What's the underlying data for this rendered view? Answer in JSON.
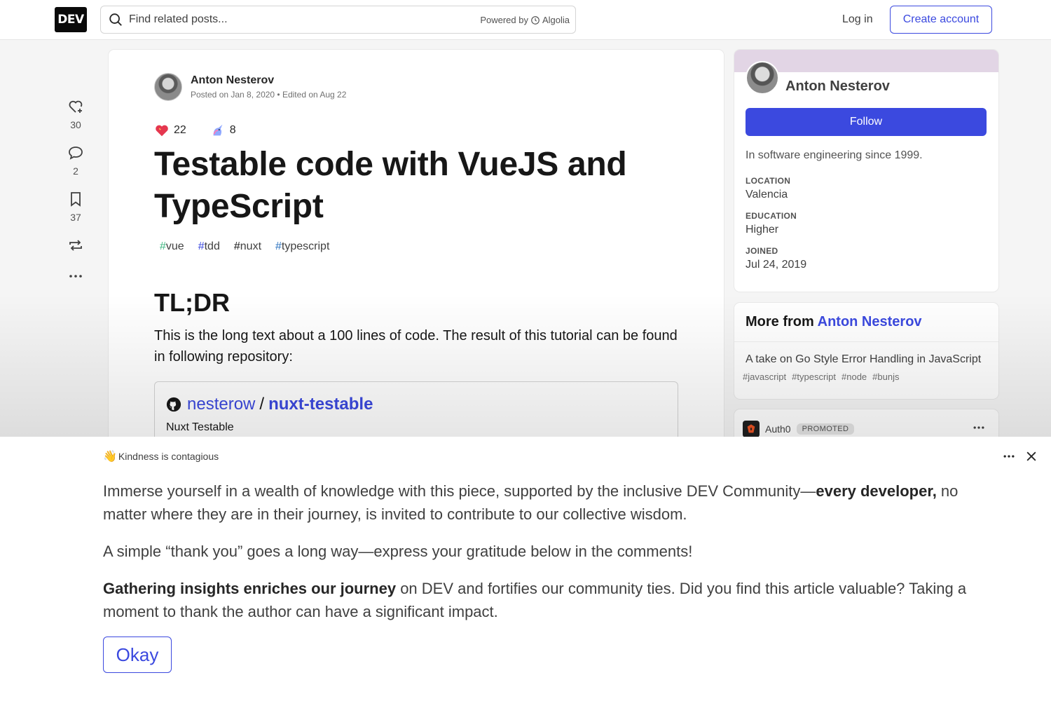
{
  "header": {
    "logo": "DEV",
    "search_placeholder": "Find related posts...",
    "powered_by": "Powered by",
    "powered_brand": "Algolia",
    "login": "Log in",
    "create_account": "Create account"
  },
  "rail": {
    "likes": "30",
    "comments": "2",
    "bookmarks": "37"
  },
  "article": {
    "author": "Anton Nesterov",
    "posted": "Posted on Jan 8, 2020 • Edited on Aug 22",
    "reactions": [
      {
        "icon": "heart-emoji",
        "count": "22"
      },
      {
        "icon": "unicorn-emoji",
        "count": "8"
      }
    ],
    "title": "Testable code with VueJS and TypeScript",
    "tags": [
      {
        "name": "vue",
        "color": "#41b883"
      },
      {
        "name": "tdd",
        "color": "#3b49df"
      },
      {
        "name": "nuxt",
        "color": "#171717"
      },
      {
        "name": "typescript",
        "color": "#2f74c0"
      }
    ],
    "heading": "TL;DR",
    "paragraph": "This is the long text about a 100 lines of code. The result of this tutorial can be found in following repository:",
    "repo": {
      "owner": "nesterow",
      "slash": "/",
      "name": "nuxt-testable",
      "description": "Nuxt Testable"
    }
  },
  "profile": {
    "name": "Anton Nesterov",
    "follow": "Follow",
    "bio": "In software engineering since 1999.",
    "facts": [
      {
        "key": "LOCATION",
        "value": "Valencia"
      },
      {
        "key": "EDUCATION",
        "value": "Higher"
      },
      {
        "key": "JOINED",
        "value": "Jul 24, 2019"
      }
    ]
  },
  "more_from": {
    "label": "More from",
    "author": "Anton Nesterov",
    "post_title": "A take on Go Style Error Handling in JavaScript",
    "post_tags": [
      "#javascript",
      "#typescript",
      "#node",
      "#bunjs"
    ]
  },
  "promo": {
    "name": "Auth0",
    "badge": "PROMOTED"
  },
  "banner": {
    "heading_emoji": "👋",
    "heading": "Kindness is contagious",
    "p1_a": "Immerse yourself in a wealth of knowledge with this piece, supported by the inclusive DEV Community—",
    "p1_b": "every developer,",
    "p1_c": " no matter where they are in their journey, is invited to contribute to our collective wisdom.",
    "p2": "A simple “thank you” goes a long way—express your gratitude below in the comments!",
    "p3_a": "Gathering insights enriches our journey",
    "p3_b": " on DEV and fortifies our community ties. Did you find this article valuable? Taking a moment to thank the author can have a significant impact.",
    "okay": "Okay"
  }
}
